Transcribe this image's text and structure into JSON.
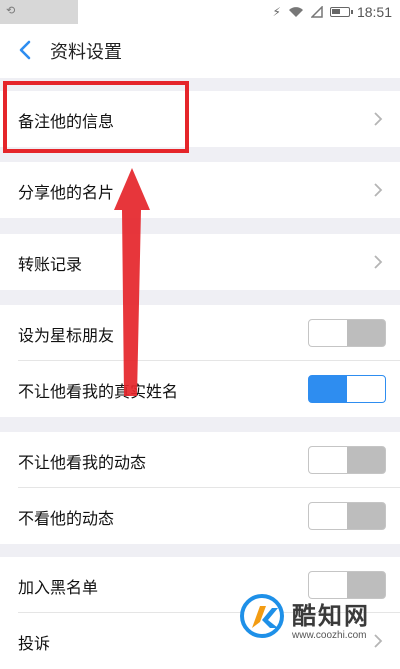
{
  "status_bar": {
    "time": "18:51",
    "battery_level": 0.6
  },
  "header": {
    "title": "资料设置"
  },
  "rows": [
    {
      "label": "备注他的信息"
    },
    {
      "label": "分享他的名片"
    },
    {
      "label": "转账记录"
    }
  ],
  "toggles": [
    {
      "label": "设为星标朋友",
      "on": false
    },
    {
      "label": "不让他看我的真实姓名",
      "on": true
    },
    {
      "label": "不让他看我的动态",
      "on": false
    },
    {
      "label": "不看他的动态",
      "on": false
    },
    {
      "label": "加入黑名单",
      "on": false
    }
  ],
  "report": {
    "label": "投诉"
  },
  "watermark": {
    "name": "酷知网",
    "url": "www.coozhi.com"
  },
  "colors": {
    "accent": "#2e8df0",
    "highlight": "#e5252a"
  }
}
